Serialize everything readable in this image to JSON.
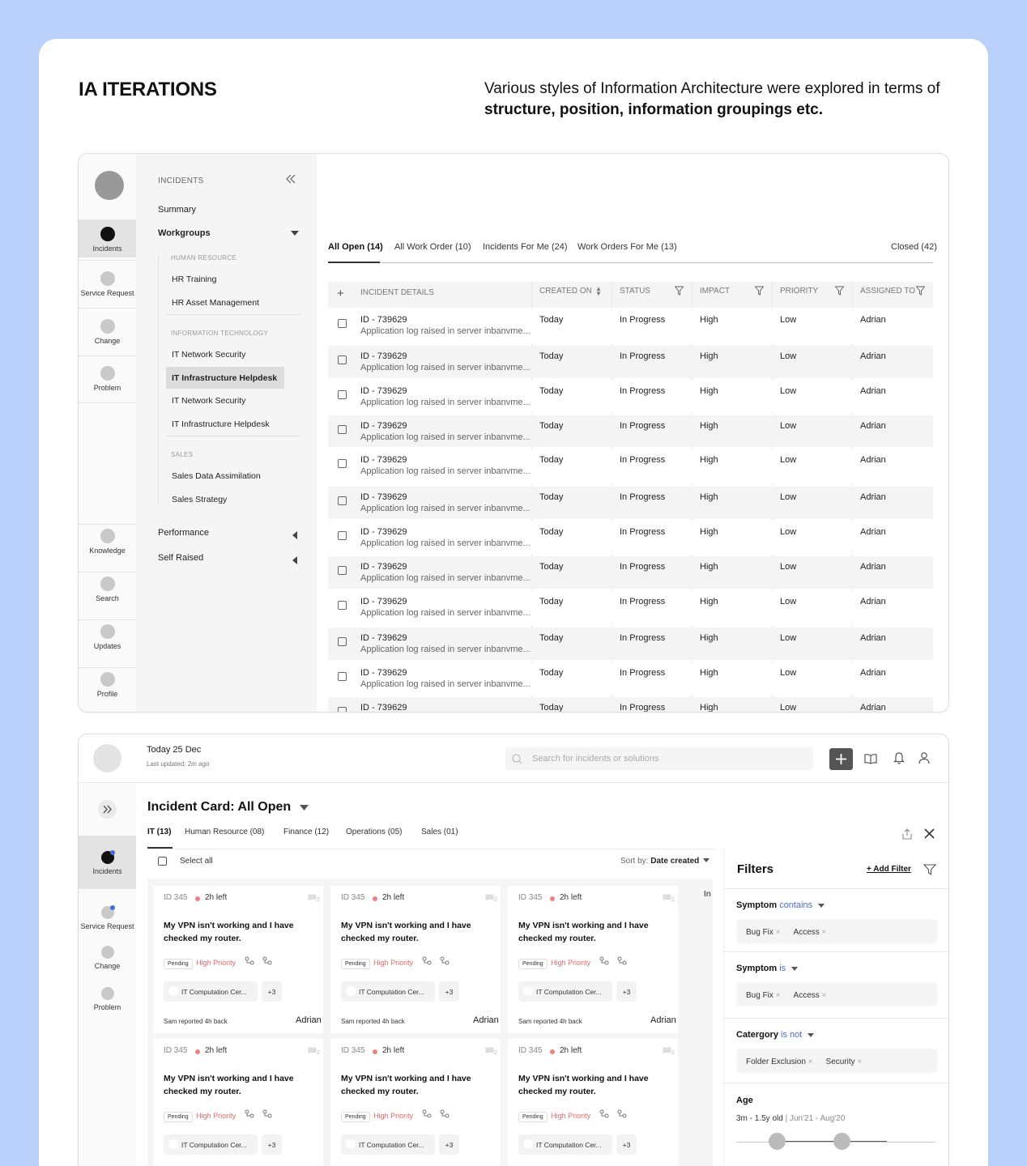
{
  "header": {
    "title": "IA ITERATIONS",
    "desc_line1": "Various styles of Information Architecture were explored in terms of",
    "desc_line2": "structure, position, information groupings etc."
  },
  "v1": {
    "nav": [
      {
        "label": "Incidents",
        "active": true
      },
      {
        "label": "Service Request"
      },
      {
        "label": "Change"
      },
      {
        "label": "Problem"
      },
      {
        "label": "Knowledge"
      },
      {
        "label": "Search"
      },
      {
        "label": "Updates"
      },
      {
        "label": "Profile"
      }
    ],
    "tree": {
      "heading": "INCIDENTS",
      "summary": "Summary",
      "workgroups": "Workgroups",
      "groups": [
        {
          "name": "HUMAN RESOURCE",
          "items": [
            "HR Training",
            "HR Asset Management"
          ]
        },
        {
          "name": "INFORMATION TECHNOLOGY",
          "items": [
            "IT Network Security",
            "IT Infrastructure Helpdesk",
            "IT Network Security",
            "IT Infrastructure Helpdesk"
          ]
        },
        {
          "name": "SALES",
          "items": [
            "Sales Data Assimilation",
            "Sales Strategy"
          ]
        }
      ],
      "performance": "Performance",
      "self_raised": "Self Raised"
    },
    "tabs": [
      "All Open (14)",
      "All Work Order (10)",
      "Incidents For Me (24)",
      "Work Orders For Me (13)"
    ],
    "closed_tab": "Closed (42)",
    "columns": [
      "INCIDENT DETAILS",
      "CREATED ON",
      "STATUS",
      "IMPACT",
      "PRIORITY",
      "ASSIGNED TO"
    ],
    "row": {
      "id": "ID - 739629",
      "desc": "Application log raised in server inbanvme...",
      "created": "Today",
      "status": "In Progress",
      "impact": "High",
      "priority": "Low",
      "assigned": "Adrian"
    }
  },
  "v2": {
    "date": "Today 25 Dec",
    "updated": "Last updated: 2m ago",
    "search_placeholder": "Search for incidents or solutions",
    "nav": [
      "Incidents",
      "Service Request",
      "Change",
      "Problem"
    ],
    "view_title": "Incident Card: All Open",
    "tabs": [
      "IT (13)",
      "Human Resource (08)",
      "Finance (12)",
      "Operations (05)",
      "Sales (01)"
    ],
    "select_all": "Select all",
    "sort_label": "Sort by:",
    "sort_value": "Date created",
    "peek": "In",
    "card": {
      "id": "ID 345",
      "time": "2h left",
      "comments": "2",
      "title_line1": "My VPN isn't working and I have",
      "title_line2": "checked my router.",
      "status": "Pending",
      "priority": "High Priority",
      "group": "IT Computation Cer...",
      "more": "+3",
      "reported": "Sam reported 4h back",
      "assignee": "Adrian"
    },
    "filters": {
      "title": "Filters",
      "add": "+ Add Filter",
      "sections": [
        {
          "label": "Symptom",
          "op": "contains",
          "tags": [
            "Bug Fix",
            "Access"
          ]
        },
        {
          "label": "Symptom",
          "op": "is",
          "tags": [
            "Bug Fix",
            "Access"
          ]
        },
        {
          "label": "Catergory",
          "op": "is not",
          "tags": [
            "Folder Exclusion",
            "Security"
          ]
        }
      ],
      "age_label": "Age",
      "age_value": "3m - 1.5y old",
      "age_range": "Jun'21 - Aug'20"
    }
  }
}
